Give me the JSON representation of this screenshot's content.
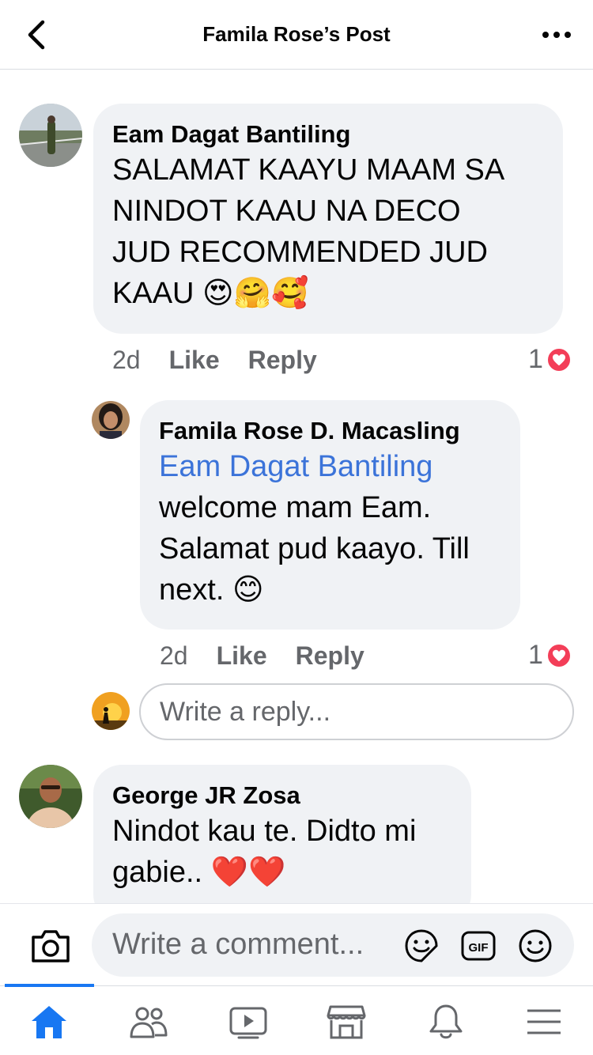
{
  "header": {
    "title": "Famila Rose’s Post"
  },
  "comments": [
    {
      "author": "Eam Dagat Bantiling",
      "text_lines": [
        "SALAMAT KAAYU MAAM SA",
        "NINDOT KAAU NA DECO",
        "JUD RECOMMENDED JUD",
        "KAAU 😍🤗🥰"
      ],
      "time": "2d",
      "like_label": "Like",
      "reply_label": "Reply",
      "reaction_count": "1"
    },
    {
      "author": "Famila Rose D. Macasling",
      "tag": "Eam Dagat Bantiling",
      "text_lines": [
        "welcome mam Eam.",
        "Salamat pud kaayo. Till",
        "next. 😊"
      ],
      "time": "2d",
      "like_label": "Like",
      "reply_label": "Reply",
      "reaction_count": "1"
    },
    {
      "author": "George JR Zosa",
      "text_lines": [
        "Nindot kau te. Didto mi",
        "gabie.. ❤️❤️"
      ]
    }
  ],
  "reply_input": {
    "placeholder": "Write a reply..."
  },
  "composer": {
    "placeholder": "Write a comment..."
  },
  "tabbar": {
    "active": "home",
    "tabs": [
      "home",
      "friends",
      "watch",
      "marketplace",
      "notifications",
      "menu"
    ],
    "accent": "#1877f2"
  },
  "colors": {
    "tag": "#3b73d9",
    "heart": "#f33e58",
    "bubble": "#f0f2f5"
  }
}
